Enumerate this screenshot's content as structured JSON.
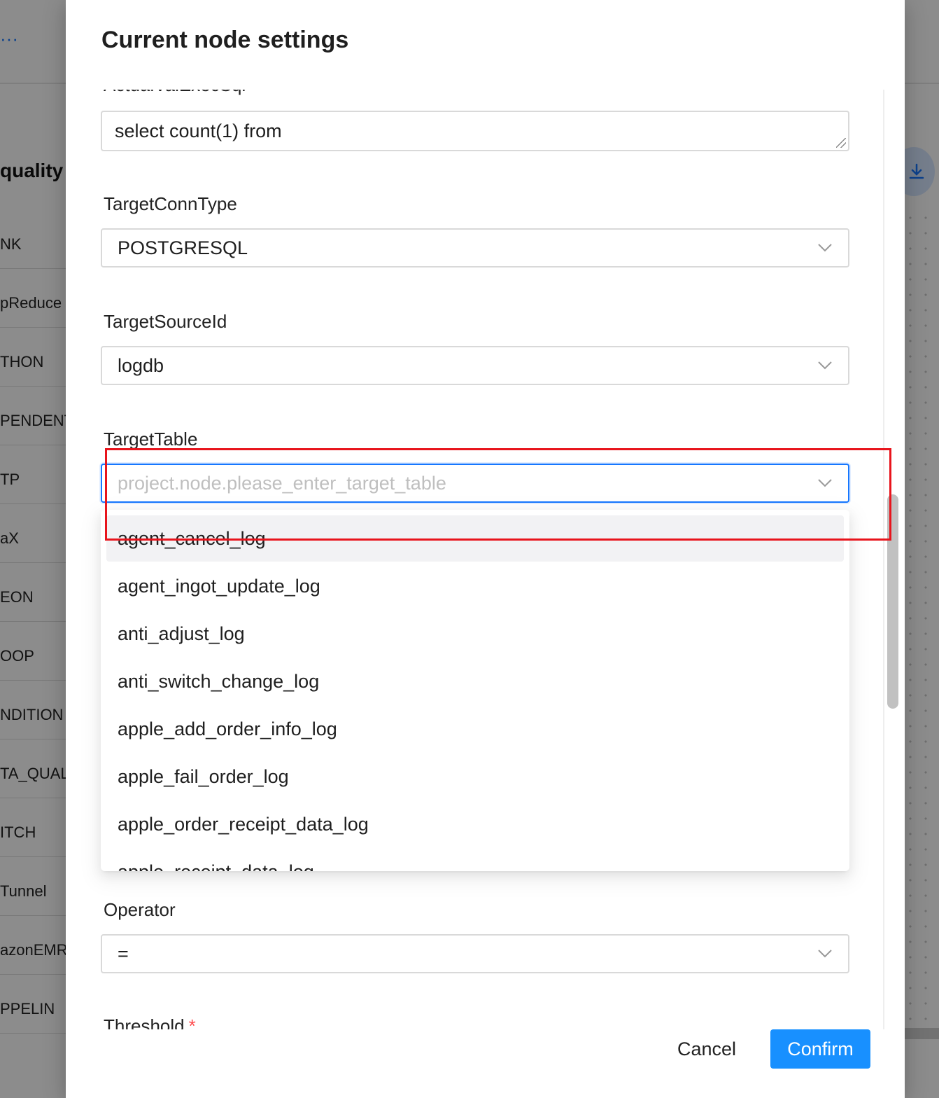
{
  "background": {
    "ellipsis": "···",
    "panel_title": "quality",
    "task_items": [
      "NK",
      "pReduce",
      "THON",
      "PENDENT",
      "TP",
      "aX",
      "EON",
      "OOP",
      "NDITION",
      "TA_QUAL",
      "ITCH",
      "Tunnel",
      "azonEMR",
      "PPELIN"
    ],
    "download_icon": "download-icon"
  },
  "modal": {
    "title": "Current node settings",
    "clipped_label": "ActualValExecSql",
    "actual_sql": "select count(1) from",
    "target_conn_type": {
      "label": "TargetConnType",
      "value": "POSTGRESQL"
    },
    "target_source_id": {
      "label": "TargetSourceId",
      "value": "logdb"
    },
    "target_table": {
      "label": "TargetTable",
      "placeholder": "project.node.please_enter_target_table",
      "options": [
        "agent_cancel_log",
        "agent_ingot_update_log",
        "anti_adjust_log",
        "anti_switch_change_log",
        "apple_add_order_info_log",
        "apple_fail_order_log",
        "apple_order_receipt_data_log",
        "apple_receipt_data_log"
      ]
    },
    "operator": {
      "label": "Operator",
      "value": "="
    },
    "threshold": {
      "label": "Threshold",
      "required": "*"
    },
    "cancel_label": "Cancel",
    "confirm_label": "Confirm"
  },
  "colors": {
    "primary": "#1890ff",
    "annotation": "#e8141c",
    "required": "#ff4d4f"
  }
}
